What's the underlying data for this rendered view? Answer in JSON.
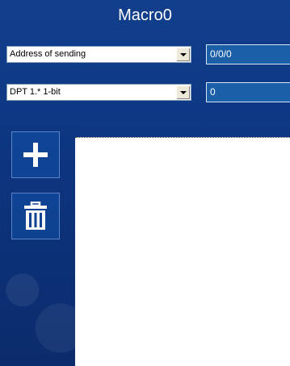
{
  "title": "Macro0",
  "address_row": {
    "select_label": "Address of sending",
    "value": "0/0/0"
  },
  "dpt_row": {
    "select_label": "DPT 1.* 1-bit",
    "value": "0"
  },
  "sidebar": {
    "add_icon": "plus-icon",
    "delete_icon": "trash-icon"
  },
  "colors": {
    "panel_blue": "#0d3682",
    "field_blue": "#1b5fa8",
    "canvas": "#ffffff"
  }
}
